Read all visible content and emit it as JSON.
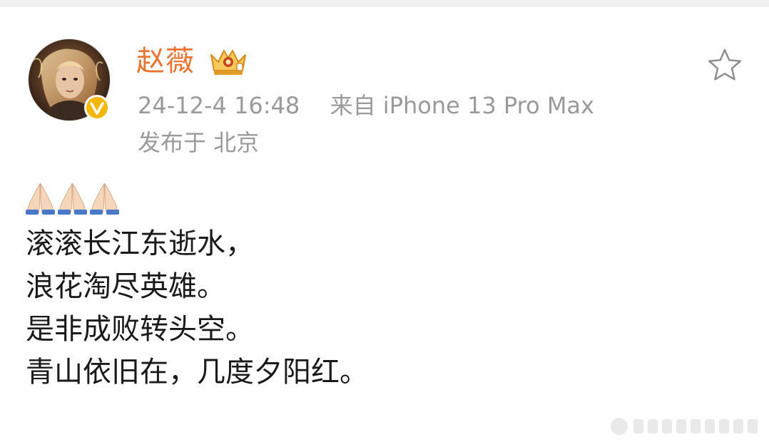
{
  "post": {
    "author": "赵薇",
    "timestamp": "24-12-4 16:48",
    "source": "来自 iPhone 13 Pro Max",
    "location": "发布于 北京",
    "emojis": [
      "🙏",
      "🙏",
      "🙏"
    ],
    "lines": [
      "滚滚长江东逝水，",
      "浪花淘尽英雄。",
      "是非成败转头空。",
      "青山依旧在，几度夕阳红。"
    ]
  },
  "icons": {
    "avatar": "avatar-image",
    "verified": "verified-v-icon",
    "crown": "crown-badge-icon",
    "star": "star-outline-icon",
    "emoji": "praying-hands-icon",
    "watermark": "watermark-icon"
  },
  "colors": {
    "username": "#e8742f",
    "meta": "#9a9a9a",
    "verified": "#f5b700",
    "text": "#1a1a1a"
  }
}
